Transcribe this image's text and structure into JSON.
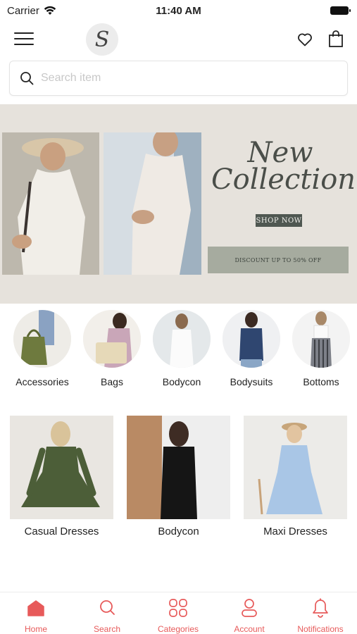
{
  "status_bar": {
    "carrier": "Carrier",
    "time": "11:40 AM"
  },
  "header": {
    "logo_text": "S"
  },
  "search": {
    "placeholder": "Search item"
  },
  "banner": {
    "title_line1": "New",
    "title_line2": "Collection",
    "cta_label": "SHOP NOW",
    "discount_text": "DISCOUNT UP TO 50% OFF"
  },
  "categories": [
    {
      "label": "Accessories"
    },
    {
      "label": "Bags"
    },
    {
      "label": "Bodycon"
    },
    {
      "label": "Bodysuits"
    },
    {
      "label": "Bottoms"
    }
  ],
  "products": [
    {
      "label": "Casual Dresses"
    },
    {
      "label": "Bodycon"
    },
    {
      "label": "Maxi Dresses"
    }
  ],
  "tab_bar": {
    "items": [
      {
        "label": "Home",
        "icon": "home-icon",
        "active": true
      },
      {
        "label": "Search",
        "icon": "search-icon",
        "active": false
      },
      {
        "label": "Categories",
        "icon": "grid-icon",
        "active": false
      },
      {
        "label": "Account",
        "icon": "user-icon",
        "active": false
      },
      {
        "label": "Notifications",
        "icon": "bell-icon",
        "active": false
      }
    ]
  },
  "colors": {
    "accent": "#e75a5a",
    "banner_bg": "#e6e2dc",
    "cta_bg": "#4f5751",
    "discount_bg": "#a6ab9f"
  }
}
